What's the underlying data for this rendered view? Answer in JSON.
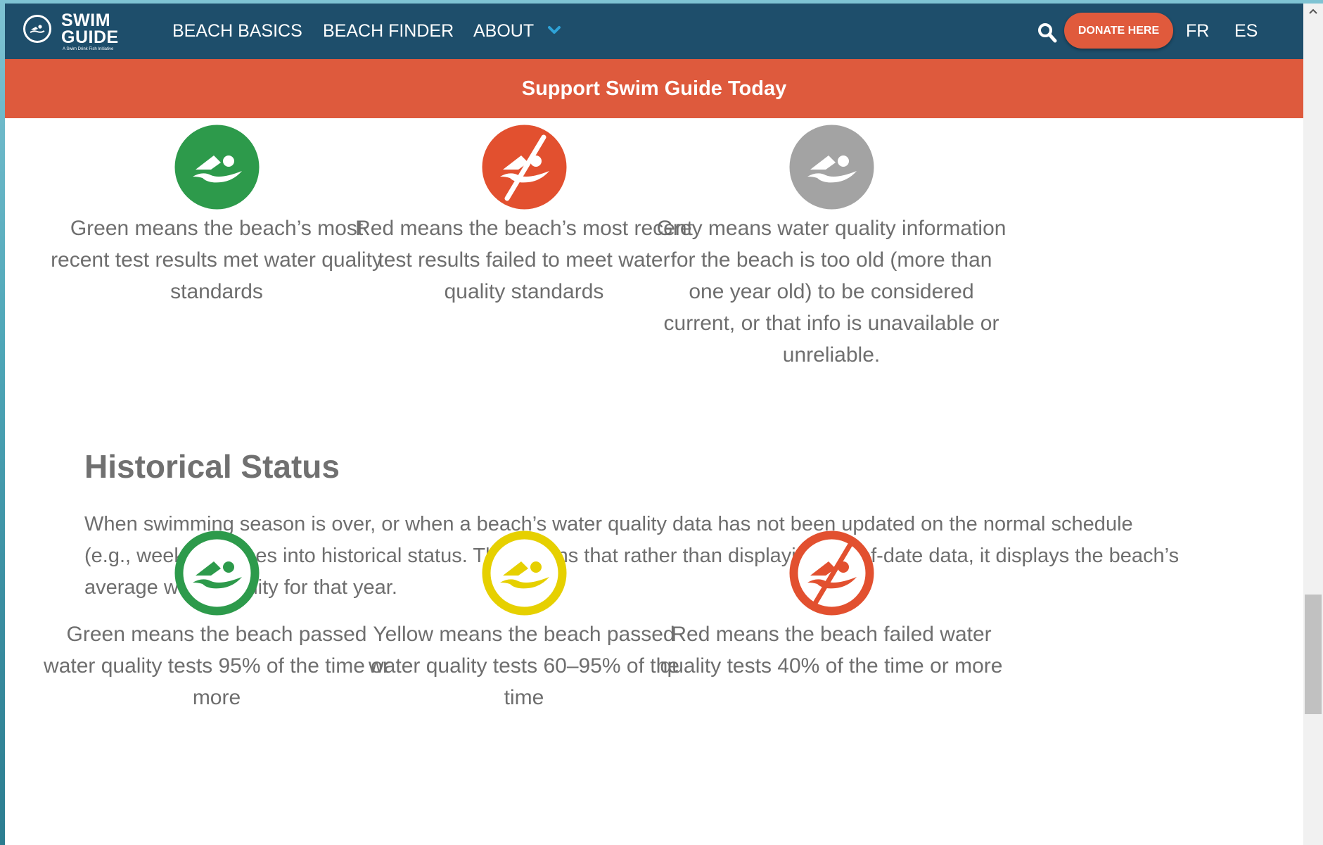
{
  "brand": {
    "title_line1": "SWIM",
    "title_line2": "GUIDE",
    "tagline": "A Swim Drink Fish Initiative"
  },
  "nav": {
    "items": [
      "BEACH BASICS",
      "BEACH FINDER",
      "ABOUT"
    ],
    "donate_label": "DONATE HERE",
    "languages": [
      "FR",
      "ES"
    ]
  },
  "banner": {
    "label": "Support Swim Guide Today"
  },
  "current_status": [
    {
      "color": "#2d9a4b",
      "style": "filled",
      "crossed": false,
      "icon": "swimmer-icon",
      "text": "Green means the beach’s most recent test results met water quality standards"
    },
    {
      "color": "#e2502f",
      "style": "filled",
      "crossed": true,
      "icon": "swimmer-crossed-icon",
      "text": "Red means the beach’s most recent test results failed to meet water quality standards"
    },
    {
      "color": "#a3a3a3",
      "style": "filled",
      "crossed": false,
      "icon": "swimmer-icon",
      "text": "Grey means water quality information for the beach is too old (more than one year old) to be considered current, or that info is unavailable or unreliable."
    }
  ],
  "historical": {
    "title": "Historical Status",
    "paragraph": "When swimming season is over, or when a beach’s water quality data has not been updated on the normal schedule (e.g., weekly), it goes into historical status. This means that rather than displaying out-of-date data, it displays the beach’s average water quality for that year.",
    "items": [
      {
        "color": "#2d9a4b",
        "style": "ring",
        "crossed": false,
        "icon": "swimmer-icon",
        "text": "Green means the beach passed water quality tests 95% of the time or more"
      },
      {
        "color": "#e6d000",
        "style": "ring",
        "crossed": false,
        "icon": "swimmer-icon",
        "text": "Yellow means the beach passed water quality tests 60–95% of the time"
      },
      {
        "color": "#e2502f",
        "style": "ring",
        "crossed": true,
        "icon": "swimmer-crossed-icon",
        "text": "Red means the beach failed water quality tests 40% of the time or more"
      }
    ]
  }
}
